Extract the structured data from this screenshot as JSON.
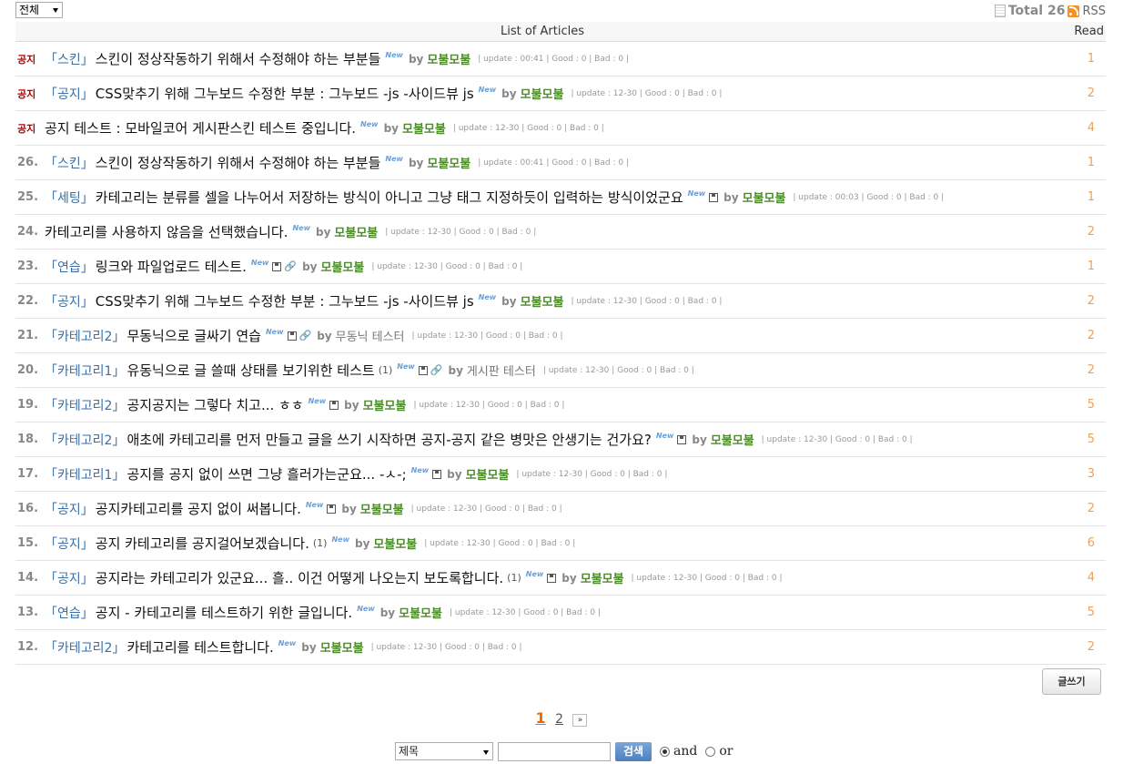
{
  "category_select": {
    "value": "전체"
  },
  "total": {
    "label": "Total 26",
    "rss_label": "RSS"
  },
  "header": {
    "title": "List of Articles",
    "read": "Read"
  },
  "rows": [
    {
      "num": "공지",
      "notice": true,
      "cat": "「스킨」",
      "subject": "스킨이 정상작동하기 위해서 수정해야 하는 부분들",
      "comments": "",
      "disk": false,
      "clip": false,
      "by": "by",
      "author": "모불모불",
      "author_plain": false,
      "meta": "| update : 00:41 | Good : 0 | Bad : 0 |",
      "read": "1"
    },
    {
      "num": "공지",
      "notice": true,
      "cat": "「공지」",
      "subject": "CSS맞추기 위해 그누보드 수정한 부분 : 그누보드 -js -사이드뷰 js",
      "comments": "",
      "disk": false,
      "clip": false,
      "by": "by",
      "author": "모불모불",
      "author_plain": false,
      "meta": "| update : 12-30 | Good : 0 | Bad : 0 |",
      "read": "2"
    },
    {
      "num": "공지",
      "notice": true,
      "cat": "",
      "subject": "공지 테스트 : 모바일코어 게시판스킨 테스트 중입니다.",
      "comments": "",
      "disk": false,
      "clip": false,
      "by": "by",
      "author": "모불모불",
      "author_plain": false,
      "meta": "| update : 12-30 | Good : 0 | Bad : 0 |",
      "read": "4"
    },
    {
      "num": "26.",
      "notice": false,
      "cat": "「스킨」",
      "subject": "스킨이 정상작동하기 위해서 수정해야 하는 부분들",
      "comments": "",
      "disk": false,
      "clip": false,
      "by": "by",
      "author": "모불모불",
      "author_plain": false,
      "meta": "| update : 00:41 | Good : 0 | Bad : 0 |",
      "read": "1"
    },
    {
      "num": "25.",
      "notice": false,
      "cat": "「세팅」",
      "subject": "카테고리는 분류를 셀을 나누어서 저장하는 방식이 아니고 그냥 태그 지정하듯이 입력하는 방식이었군요",
      "comments": "",
      "disk": true,
      "clip": false,
      "by": "by",
      "author": "모불모불",
      "author_plain": false,
      "meta": "| update : 00:03 | Good : 0 | Bad : 0 |",
      "read": "1"
    },
    {
      "num": "24.",
      "notice": false,
      "cat": "",
      "subject": "카테고리를 사용하지 않음을 선택했습니다.",
      "comments": "",
      "disk": false,
      "clip": false,
      "by": "by",
      "author": "모불모불",
      "author_plain": false,
      "meta": "| update : 12-30 | Good : 0 | Bad : 0 |",
      "read": "2"
    },
    {
      "num": "23.",
      "notice": false,
      "cat": "「연습」",
      "subject": "링크와 파일업로드 테스트.",
      "comments": "",
      "disk": true,
      "clip": true,
      "by": "by",
      "author": "모불모불",
      "author_plain": false,
      "meta": "| update : 12-30 | Good : 0 | Bad : 0 |",
      "read": "1"
    },
    {
      "num": "22.",
      "notice": false,
      "cat": "「공지」",
      "subject": "CSS맞추기 위해 그누보드 수정한 부분 : 그누보드 -js -사이드뷰 js",
      "comments": "",
      "disk": false,
      "clip": false,
      "by": "by",
      "author": "모불모불",
      "author_plain": false,
      "meta": "| update : 12-30 | Good : 0 | Bad : 0 |",
      "read": "2"
    },
    {
      "num": "21.",
      "notice": false,
      "cat": "「카테고리2」",
      "subject": "무동닉으로 글싸기 연습",
      "comments": "",
      "disk": true,
      "clip": true,
      "by": "by",
      "author": "무동닉 테스터",
      "author_plain": true,
      "meta": "| update : 12-30 | Good : 0 | Bad : 0 |",
      "read": "2"
    },
    {
      "num": "20.",
      "notice": false,
      "cat": "「카테고리1」",
      "subject": "유동닉으로 글 쓸때 상태를 보기위한 테스트",
      "comments": "(1)",
      "disk": true,
      "clip": true,
      "by": "by",
      "author": "게시판 테스터",
      "author_plain": true,
      "meta": "| update : 12-30 | Good : 0 | Bad : 0 |",
      "read": "2"
    },
    {
      "num": "19.",
      "notice": false,
      "cat": "「카테고리2」",
      "subject": "공지공지는 그렇다 치고... ㅎㅎ",
      "comments": "",
      "disk": true,
      "clip": false,
      "by": "by",
      "author": "모불모불",
      "author_plain": false,
      "meta": "| update : 12-30 | Good : 0 | Bad : 0 |",
      "read": "5"
    },
    {
      "num": "18.",
      "notice": false,
      "cat": "「카테고리2」",
      "subject": "애초에 카테고리를 먼저 만들고 글을 쓰기 시작하면 공지-공지 같은 병맛은 안생기는 건가요?",
      "comments": "",
      "disk": true,
      "clip": false,
      "by": "by",
      "author": "모불모불",
      "author_plain": false,
      "meta": "| update : 12-30 | Good : 0 | Bad : 0 |",
      "read": "5"
    },
    {
      "num": "17.",
      "notice": false,
      "cat": "「카테고리1」",
      "subject": "공지를 공지 없이 쓰면 그냥 흘러가는군요... -ㅅ-;",
      "comments": "",
      "disk": true,
      "clip": false,
      "by": "by",
      "author": "모불모불",
      "author_plain": false,
      "meta": "| update : 12-30 | Good : 0 | Bad : 0 |",
      "read": "3"
    },
    {
      "num": "16.",
      "notice": false,
      "cat": "「공지」",
      "subject": "공지카테고리를 공지 없이 써봅니다.",
      "comments": "",
      "disk": true,
      "clip": false,
      "by": "by",
      "author": "모불모불",
      "author_plain": false,
      "meta": "| update : 12-30 | Good : 0 | Bad : 0 |",
      "read": "2"
    },
    {
      "num": "15.",
      "notice": false,
      "cat": "「공지」",
      "subject": "공지 카테고리를 공지걸어보겠습니다.",
      "comments": "(1)",
      "disk": false,
      "clip": false,
      "by": "by",
      "author": "모불모불",
      "author_plain": false,
      "meta": "| update : 12-30 | Good : 0 | Bad : 0 |",
      "read": "6"
    },
    {
      "num": "14.",
      "notice": false,
      "cat": "「공지」",
      "subject": "공지라는 카테고리가 있군요... 흘.. 이건 어떻게 나오는지 보도록합니다.",
      "comments": "(1)",
      "disk": true,
      "clip": false,
      "by": "by",
      "author": "모불모불",
      "author_plain": false,
      "meta": "| update : 12-30 | Good : 0 | Bad : 0 |",
      "read": "4"
    },
    {
      "num": "13.",
      "notice": false,
      "cat": "「연습」",
      "subject": "공지 - 카테고리를 테스트하기 위한 글입니다.",
      "comments": "",
      "disk": false,
      "clip": false,
      "by": "by",
      "author": "모불모불",
      "author_plain": false,
      "meta": "| update : 12-30 | Good : 0 | Bad : 0 |",
      "read": "5"
    },
    {
      "num": "12.",
      "notice": false,
      "cat": "「카테고리2」",
      "subject": "카테고리를 테스트합니다.",
      "comments": "",
      "disk": false,
      "clip": false,
      "by": "by",
      "author": "모불모불",
      "author_plain": false,
      "meta": "| update : 12-30 | Good : 0 | Bad : 0 |",
      "read": "2"
    }
  ],
  "write_button": "글쓰기",
  "pager": {
    "current": "1",
    "page2": "2",
    "next": "»"
  },
  "search": {
    "field_value": "제목",
    "input_value": "",
    "button": "검색",
    "and_label": "and",
    "or_label": "or"
  },
  "new_label": "New",
  "colors": {
    "author": "#4e8c2e",
    "category": "#3a6ea5",
    "notice": "#b00000",
    "read": "#e8a25a",
    "pager_current": "#e86a00"
  }
}
